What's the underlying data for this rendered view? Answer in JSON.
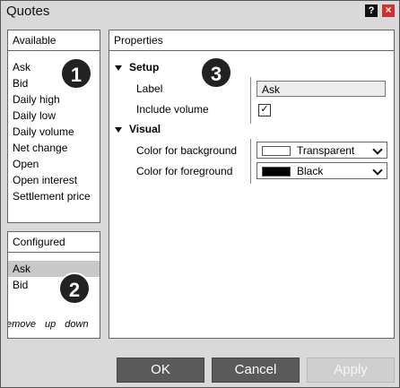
{
  "window": {
    "title": "Quotes",
    "help_label": "?",
    "close_label": "×"
  },
  "available": {
    "header": "Available",
    "badge": "1",
    "items": [
      "Ask",
      "Bid",
      "Daily high",
      "Daily low",
      "Daily volume",
      "Net change",
      "Open",
      "Open interest",
      "Settlement price"
    ]
  },
  "configured": {
    "header": "Configured",
    "badge": "2",
    "items": [
      "Ask",
      "Bid"
    ],
    "selected": "Ask",
    "actions": {
      "remove": "emove",
      "up": "up",
      "down": "down"
    }
  },
  "properties": {
    "header": "Properties",
    "badge": "3",
    "setup": {
      "title": "Setup",
      "label_label": "Label",
      "label_value": "Ask",
      "include_volume_label": "Include volume",
      "include_volume_checked": true,
      "check_glyph": "✓"
    },
    "visual": {
      "title": "Visual",
      "bg_label": "Color for background",
      "bg_value": "Transparent",
      "bg_color": "#ffffff",
      "fg_label": "Color for foreground",
      "fg_value": "Black",
      "fg_color": "#000000"
    }
  },
  "buttons": {
    "ok": "OK",
    "cancel": "Cancel",
    "apply": "Apply",
    "apply_enabled": false
  }
}
